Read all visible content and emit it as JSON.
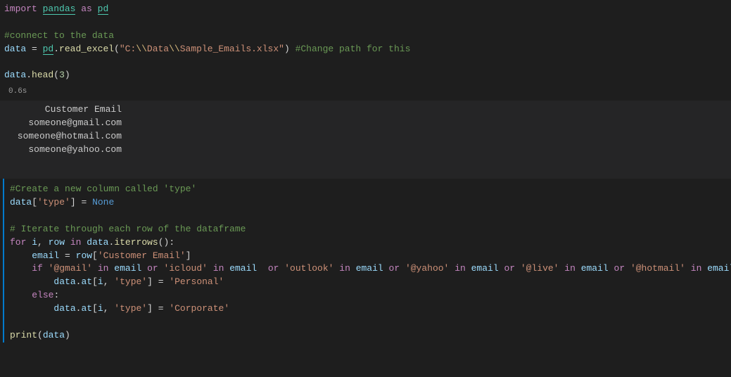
{
  "cell1": {
    "line1": {
      "import": "import",
      "pandas": "pandas",
      "as": "as",
      "pd": "pd"
    },
    "line2_spacer": "",
    "line3_comment": "#connect to the data",
    "line4": {
      "data": "data",
      "eq": " = ",
      "pd": "pd",
      "dot": ".",
      "fn": "read_excel",
      "open": "(",
      "str": "\"C:\\\\Data\\\\Sample_Emails.xlsx\"",
      "close": ") ",
      "comment": "#Change path for this"
    },
    "line5_spacer": "",
    "line6": {
      "data": "data",
      "dot": ".",
      "fn": "head",
      "open": "(",
      "num": "3",
      "close": ")"
    }
  },
  "exec_time": "0.6s",
  "output": {
    "header": "Customer Email",
    "rows": [
      "someone@gmail.com",
      "someone@hotmail.com",
      "someone@yahoo.com"
    ]
  },
  "cell2": {
    "l1_comment": "#Create a new column called 'type'",
    "l2": {
      "data": "data",
      "open": "[",
      "key": "'type'",
      "close": "]",
      "eq": " = ",
      "none": "None"
    },
    "l3_spacer": "",
    "l4_comment": "# Iterate through each row of the dataframe",
    "l5": {
      "for": "for",
      "i": "i",
      "comma": ", ",
      "row": "row",
      "in": "in",
      "data": "data",
      "dot": ".",
      "fn": "iterrows",
      "open": "(",
      "close": "):"
    },
    "l6": {
      "email": "email",
      "eq": " = ",
      "row": "row",
      "open": "[",
      "key": "'Customer Email'",
      "close": "]"
    },
    "l7": {
      "if": "if",
      "s1": "'@gmail'",
      "in1": "in",
      "email1": "email",
      "or1": "or",
      "s2": "'icloud'",
      "in2": "in",
      "email2": "email",
      "or2": "or",
      "s3": "'outlook'",
      "in3": "in",
      "email3": "email",
      "or3": "or",
      "s4": "'@yahoo'",
      "in4": "in",
      "email4": "email",
      "or4": "or",
      "s5": "'@live'",
      "in5": "in",
      "email5": "email",
      "or5": "or",
      "s6": "'@hotmail'",
      "in6": "in",
      "email6": "email",
      "colon": ":"
    },
    "l8": {
      "data": "data",
      "dot": ".",
      "at": "at",
      "open": "[",
      "i": "i",
      "comma": ", ",
      "key": "'type'",
      "close": "]",
      "eq": " = ",
      "val": "'Personal'"
    },
    "l9": {
      "else": "else",
      "colon": ":"
    },
    "l10": {
      "data": "data",
      "dot": ".",
      "at": "at",
      "open": "[",
      "i": "i",
      "comma": ", ",
      "key": "'type'",
      "close": "]",
      "eq": " = ",
      "val": "'Corporate'"
    },
    "l11_spacer": "",
    "l12": {
      "print": "print",
      "open": "(",
      "data": "data",
      "close": ")"
    }
  }
}
